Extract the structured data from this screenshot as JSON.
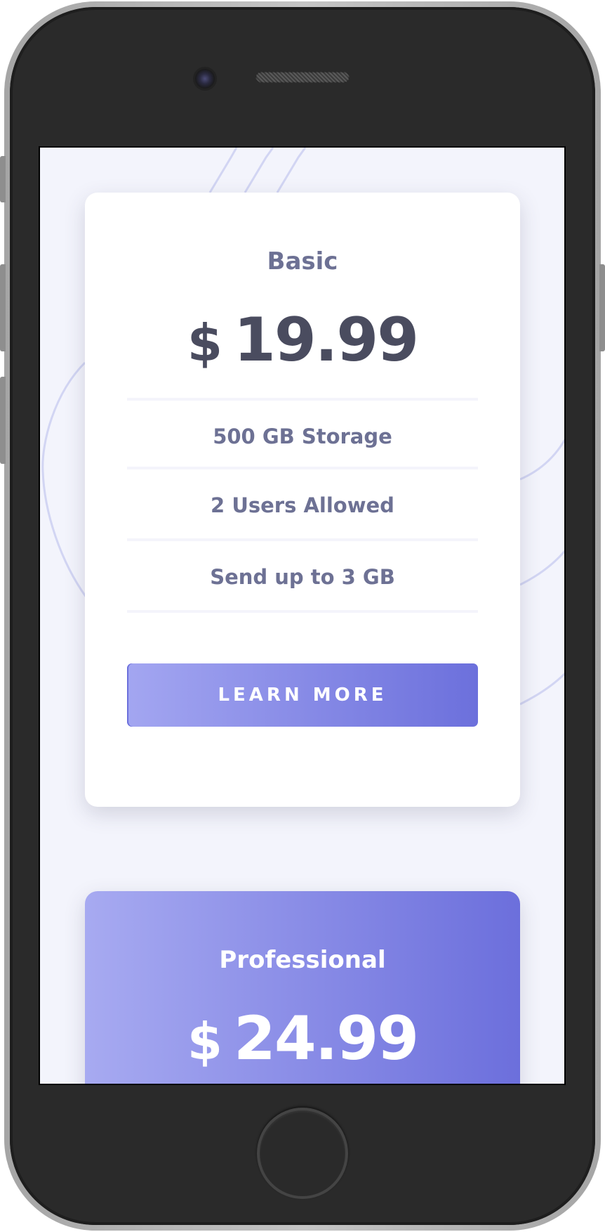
{
  "plans": [
    {
      "name": "Basic",
      "currency": "$",
      "price": "19.99",
      "features": [
        "500 GB Storage",
        "2 Users Allowed",
        "Send up to 3 GB"
      ],
      "button_label": "LEARN MORE"
    },
    {
      "name": "Professional",
      "currency": "$",
      "price": "24.99"
    }
  ],
  "colors": {
    "accent_start": "#a7aaf1",
    "accent_end": "#6c6fdc",
    "background": "#f3f4fc",
    "text_muted": "#6d7194",
    "text_dark": "#4a4c5f"
  },
  "device": {
    "frame": "iphone",
    "icons": [
      "front-camera-icon",
      "speaker-grille-icon",
      "home-button-icon"
    ]
  }
}
